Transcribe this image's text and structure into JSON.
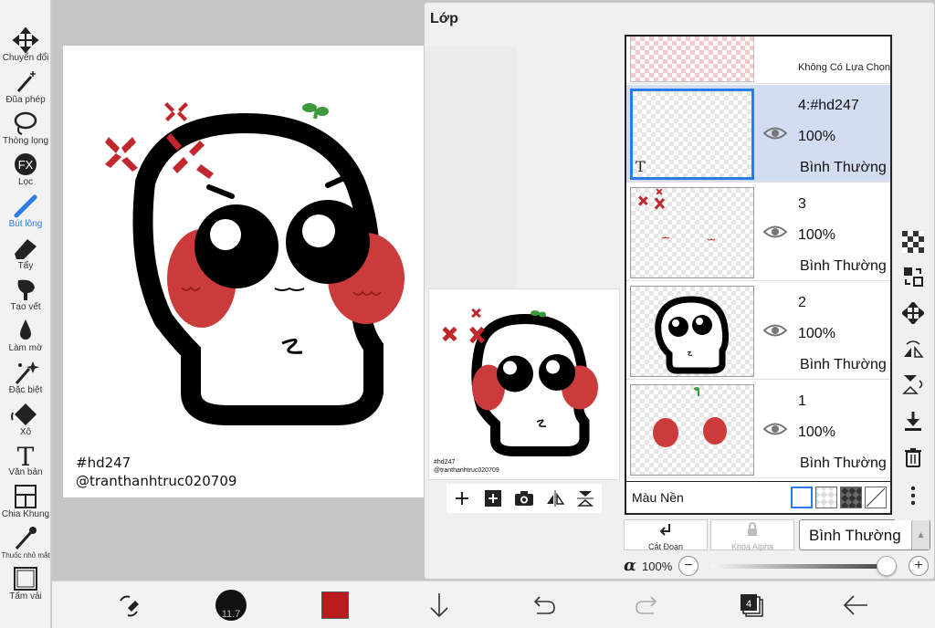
{
  "left_toolbar": {
    "tools": [
      {
        "label": "Chuyển đổi",
        "icon": "move-arrows-icon"
      },
      {
        "label": "Đũa phép",
        "icon": "magic-wand-icon"
      },
      {
        "label": "Thòng lọng",
        "icon": "lasso-icon"
      },
      {
        "label": "Lọc",
        "icon": "fx-filter-icon",
        "icon_text": "FX"
      },
      {
        "label": "Bút lông",
        "icon": "brush-icon",
        "active": true
      },
      {
        "label": "Tẩy",
        "icon": "eraser-icon"
      },
      {
        "label": "Tạo vết",
        "icon": "smudge-icon"
      },
      {
        "label": "Làm mờ",
        "icon": "blur-drop-icon"
      },
      {
        "label": "Đặc biệt",
        "icon": "special-sparkle-icon"
      },
      {
        "label": "Xô",
        "icon": "bucket-icon"
      },
      {
        "label": "Văn bản",
        "icon": "text-tool-icon",
        "icon_text": "T"
      },
      {
        "label": "Chia Khung",
        "icon": "frame-divider-icon"
      },
      {
        "label": "Thuốc nhỏ mắt",
        "icon": "eyedropper-icon"
      },
      {
        "label": "Tấm vải",
        "icon": "canvas-icon"
      }
    ],
    "active_color": "#2b7ce8"
  },
  "artwork": {
    "line1": "#hd247",
    "line2": "@tranthanhtruc020709"
  },
  "layer_panel": {
    "title": "Lớp",
    "preview": {
      "line1": "#hd247",
      "line2": "@tranthanhtruc020709"
    },
    "no_selection_label": "Không Có Lựa Chọn",
    "layers": [
      {
        "name": "4:#hd247",
        "opacity": "100%",
        "blend": "Bình Thường",
        "selected": true,
        "text_marker": "T"
      },
      {
        "name": "3",
        "opacity": "100%",
        "blend": "Bình Thường",
        "selected": false
      },
      {
        "name": "2",
        "opacity": "100%",
        "blend": "Bình Thường",
        "selected": false
      },
      {
        "name": "1",
        "opacity": "100%",
        "blend": "Bình Thường",
        "selected": false
      }
    ],
    "background_label": "Màu Nền",
    "clip_label": "Cắt Đoạn",
    "alpha_lock_label": "Khóa Alpha",
    "blend_mode": "Bình Thường",
    "alpha_symbol": "α",
    "alpha_value": "100%",
    "alpha_level": 1.0,
    "minus": "−",
    "plus": "+"
  },
  "bottom_toolbar": {
    "brush_size": "11.7",
    "primary_color": "#b81c1c",
    "layer_count": "4"
  },
  "colors": {
    "selection_blue": "#2b7ce8",
    "anger_red": "#c0282d",
    "blush_red": "#cc3b3b",
    "sprout_green": "#3c9a3c"
  }
}
